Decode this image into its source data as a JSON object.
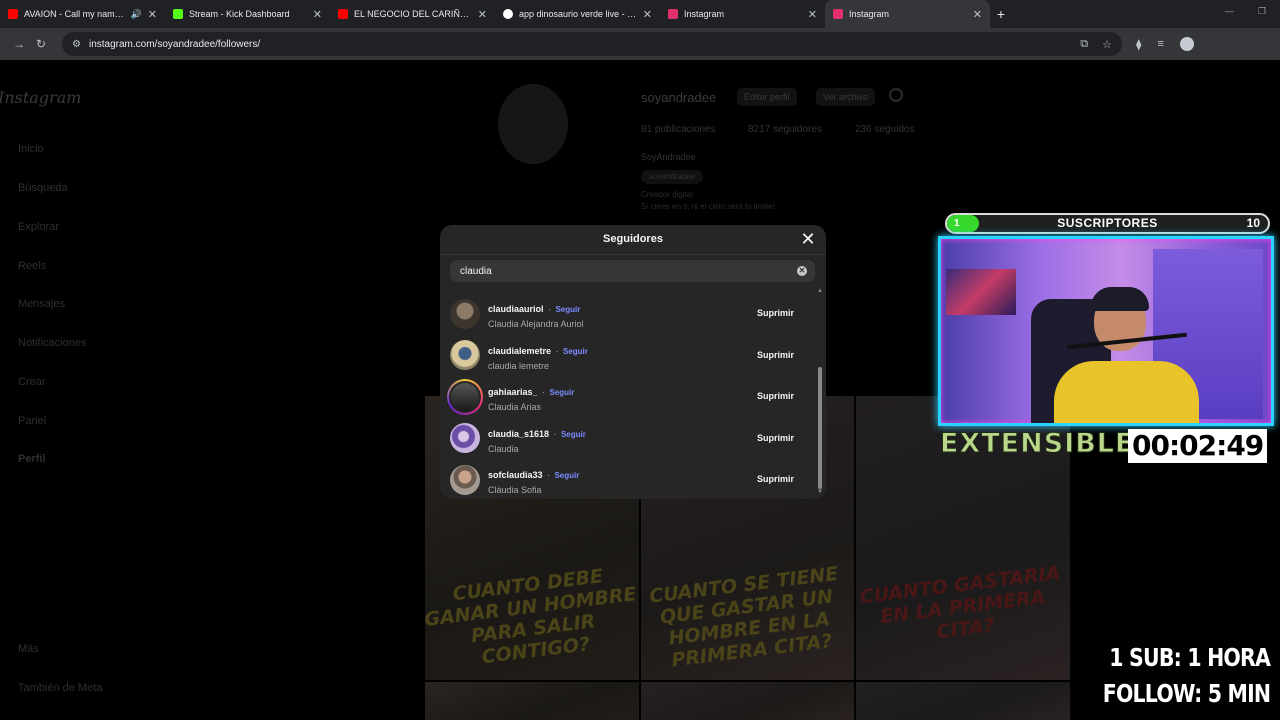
{
  "browser": {
    "tabs": [
      {
        "title": "AVAION - Call my name (O",
        "favicon_color": "#ff0000",
        "audio": true
      },
      {
        "title": "Stream - Kick Dashboard",
        "favicon_color": "#53fc18"
      },
      {
        "title": "EL NEGOCIO DEL CARIÑO MAS",
        "favicon_color": "#ff0000"
      },
      {
        "title": "app dinosaurio verde live - Bus",
        "favicon_color": "#ffffff"
      },
      {
        "title": "Instagram",
        "favicon_color": "#e1306c"
      },
      {
        "title": "Instagram",
        "favicon_color": "#e1306c",
        "active": true
      }
    ],
    "new_tab": "+",
    "url": "instagram.com/soyandradee/followers/"
  },
  "instagram_bg": {
    "logo": "Instagram",
    "sidebar": [
      "Inicio",
      "Búsqueda",
      "Explorar",
      "Reels",
      "Mensajes",
      "Notificaciones",
      "Crear",
      "Panel",
      "Perfil"
    ],
    "sidebar_bottom": [
      "Más",
      "También de Meta"
    ],
    "username": "soyandradee",
    "edit_profile": "Editar perfil",
    "view_archive": "Ver archivo",
    "stats": {
      "posts": "81 publicaciones",
      "followers": "8217 seguidores",
      "following": "236 seguidos"
    },
    "display_name": "SoyAndradee",
    "threads": "soyandradee",
    "category": "Creador digital",
    "bio": "Si crees en ti, ni el cielo será tu limite!",
    "post_captions": [
      "CUANTO DEBE GANAR UN HOMBRE PARA SALIR CONTIGO?",
      "CUANTO SE TIENE QUE GASTAR UN HOMBRE EN LA PRIMERA CITA?",
      "CUANTO GASTARIA EN LA PRIMERA CITA?"
    ]
  },
  "modal": {
    "title": "Seguidores",
    "search_value": "claudia",
    "follow_label": "Seguir",
    "remove_label": "Suprimir",
    "followers": [
      {
        "username": "claudiaauriol",
        "full_name": "Claudia Alejandra Auriol"
      },
      {
        "username": "claudialemetre",
        "full_name": "claudia lemetre"
      },
      {
        "username": "gahiaarias_",
        "full_name": "Claudia Arias"
      },
      {
        "username": "claudia_s1618",
        "full_name": "Claudia"
      },
      {
        "username": "sofclaudia33",
        "full_name": "Cláudia Sofia"
      }
    ]
  },
  "overlay": {
    "subs_current": "1",
    "subs_label": "SUSCRIPTORES",
    "subs_goal": "10",
    "subs_progress": 0.1,
    "extensible": "EXTENSIBLE",
    "timer": "00:02:49",
    "promo_sub": "1 SUB: 1 HORA",
    "promo_follow": "FOLLOW: 5 MIN"
  }
}
